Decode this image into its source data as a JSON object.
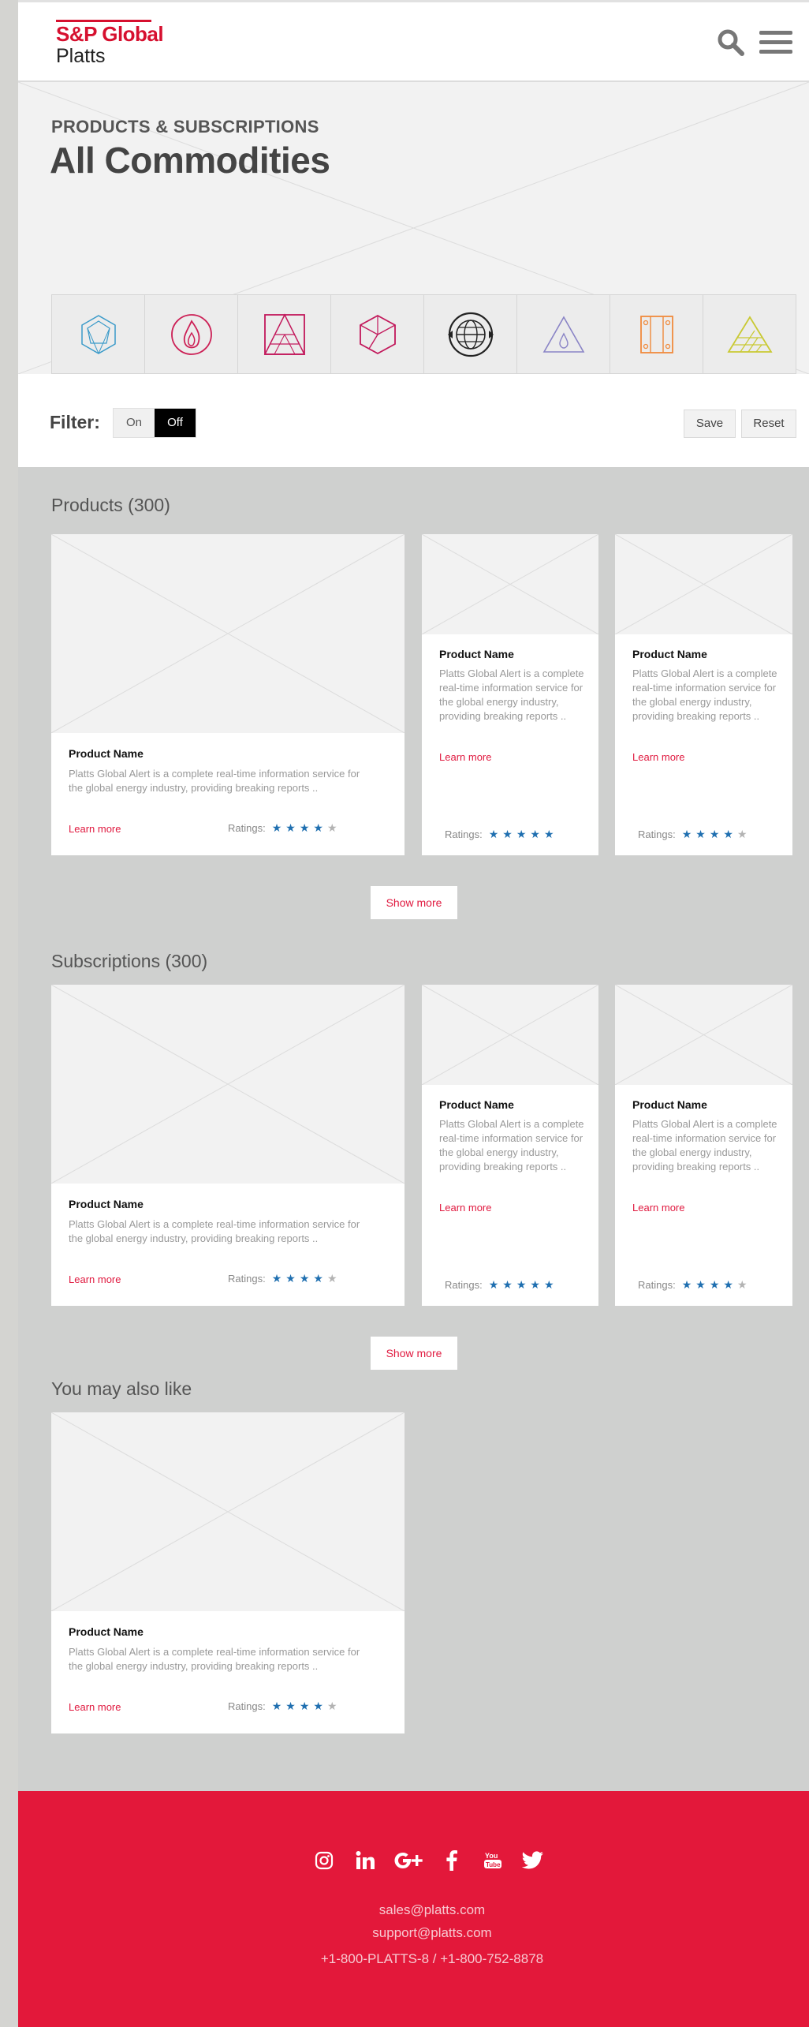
{
  "header": {
    "brand": "S&P Global",
    "brand_sub": "Platts"
  },
  "hero": {
    "eyebrow": "PRODUCTS & SUBSCRIPTIONS",
    "title": "All Commodities",
    "commodities": [
      {
        "icon": "hexagon-gem-icon",
        "color": "#3a9ac9"
      },
      {
        "icon": "flame-icon",
        "color": "#cc1f55"
      },
      {
        "icon": "pyramid-box-icon",
        "color": "#c2185b"
      },
      {
        "icon": "cube-icon",
        "color": "#c2185b"
      },
      {
        "icon": "globe-arrows-icon",
        "color": "#222222"
      },
      {
        "icon": "triangle-drop-icon",
        "color": "#8a84c6"
      },
      {
        "icon": "panel-rivets-icon",
        "color": "#f08a3c"
      },
      {
        "icon": "grain-pyramid-icon",
        "color": "#c9c933"
      }
    ]
  },
  "filter": {
    "label": "Filter:",
    "on": "On",
    "off": "Off",
    "save": "Save",
    "reset": "Reset"
  },
  "products": {
    "title": "Products (300)",
    "show_more": "Show more",
    "cards": [
      {
        "name": "Product Name",
        "desc": "Platts Global Alert is a complete real-time information service for the global energy industry, providing breaking reports ..",
        "learn": "Learn more",
        "ratings_label": "Ratings:",
        "rating": 4
      },
      {
        "name": "Product Name",
        "desc": "Platts Global Alert is a complete real-time information service for the global energy industry, providing breaking reports ..",
        "learn": "Learn more",
        "ratings_label": "Ratings:",
        "rating": 5
      },
      {
        "name": "Product Name",
        "desc": "Platts Global Alert is a complete real-time information service for the global energy industry, providing breaking reports ..",
        "learn": "Learn more",
        "ratings_label": "Ratings:",
        "rating": 4
      }
    ]
  },
  "subscriptions": {
    "title": "Subscriptions (300)",
    "show_more": "Show more",
    "cards": [
      {
        "name": "Product Name",
        "desc": "Platts Global Alert is a complete real-time information service for the global energy industry, providing breaking reports ..",
        "learn": "Learn more",
        "ratings_label": "Ratings:",
        "rating": 4
      },
      {
        "name": "Product Name",
        "desc": "Platts Global Alert is a complete real-time information service for the global energy industry, providing breaking reports ..",
        "learn": "Learn more",
        "ratings_label": "Ratings:",
        "rating": 5
      },
      {
        "name": "Product Name",
        "desc": "Platts Global Alert is a complete real-time information service for the global energy industry, providing breaking reports ..",
        "learn": "Learn more",
        "ratings_label": "Ratings:",
        "rating": 4
      }
    ]
  },
  "also_like": {
    "title": "You may also like",
    "cards": [
      {
        "name": "Product Name",
        "desc": "Platts Global Alert is a complete real-time information service for the global energy industry, providing breaking reports ..",
        "learn": "Learn more",
        "ratings_label": "Ratings:",
        "rating": 4
      }
    ]
  },
  "footer": {
    "socials": [
      "instagram-icon",
      "linkedin-icon",
      "google-plus-icon",
      "facebook-icon",
      "youtube-icon",
      "twitter-icon"
    ],
    "email_sales": "sales@platts.com",
    "email_support": "support@platts.com",
    "phone": "+1-800-PLATTS-8 / +1-800-752-8878"
  },
  "colors": {
    "accent": "#e3183a",
    "star": "#1f6fb0",
    "link": "#e0193f"
  }
}
